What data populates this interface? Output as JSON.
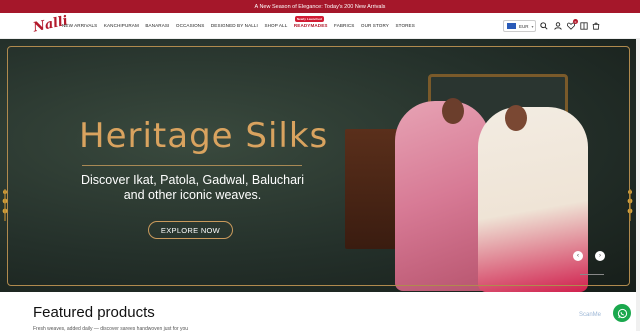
{
  "announcement": "A New Season of Elegance: Today's 200 New Arrivals",
  "brand": {
    "logo_text": "Nalli"
  },
  "menu": [
    {
      "label": "NEW ARRIVALS"
    },
    {
      "label": "KANCHIPURAM"
    },
    {
      "label": "BANARASI"
    },
    {
      "label": "OCCASIONS"
    },
    {
      "label": "DESIGNED BY NALLI"
    },
    {
      "label": "SHOP ALL"
    },
    {
      "label": "READYMADES",
      "badge": "Newly Launched"
    },
    {
      "label": "FABRICS"
    },
    {
      "label": "OUR STORY"
    },
    {
      "label": "STORES"
    }
  ],
  "currency": {
    "code": "EUR"
  },
  "icons": [
    "search-icon",
    "account-icon",
    "wishlist-icon",
    "compare-icon",
    "cart-icon"
  ],
  "cart_count": "0",
  "hero": {
    "title": "Heritage Silks",
    "subtitle_line1": "Discover Ikat, Patola, Gadwal, Baluchari",
    "subtitle_line2": "and other iconic weaves.",
    "cta": "EXPLORE NOW"
  },
  "featured": {
    "heading": "Featured products",
    "description": "Fresh weaves, added daily — discover sarees handwoven just for you"
  },
  "widgets": {
    "scan_label": "ScanMe"
  },
  "colors": {
    "brand_red": "#a5172a",
    "gold": "#d9a35f",
    "whatsapp": "#1aa84d"
  }
}
